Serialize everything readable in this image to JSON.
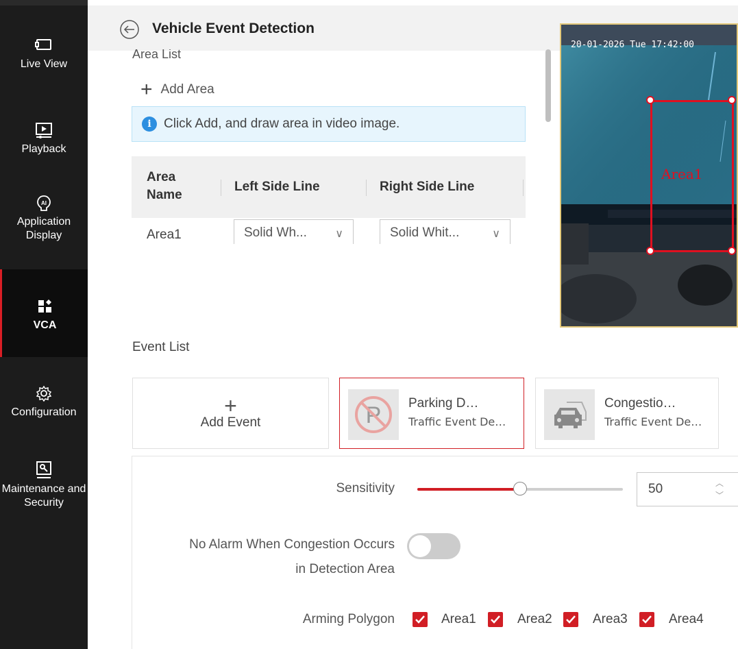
{
  "sidebar": {
    "items": [
      {
        "label": "Live View",
        "icon": "monitor-icon"
      },
      {
        "label": "Playback",
        "icon": "playback-icon"
      },
      {
        "label": "Application Display",
        "icon": "ai-icon"
      },
      {
        "label": "VCA",
        "icon": "vca-icon",
        "active": true
      },
      {
        "label": "Configuration",
        "icon": "gear-icon"
      },
      {
        "label": "Maintenance and Security",
        "icon": "maintenance-icon"
      }
    ]
  },
  "header": {
    "title": "Vehicle Event Detection"
  },
  "area_list": {
    "section_label": "Area List",
    "add_label": "Add Area",
    "info_text": "Click Add, and draw area in video image.",
    "columns": [
      "Area Name",
      "Left Side Line",
      "Right Side Line"
    ],
    "rows": [
      {
        "name": "Area1",
        "left_line": "Solid Wh...",
        "right_line": "Solid Whit..."
      }
    ]
  },
  "video": {
    "timestamp": "20-01-2026 Tue 17:42:00",
    "area_label": "Area1"
  },
  "event_list": {
    "title": "Event List",
    "add_label": "Add Event",
    "cards": [
      {
        "name": "Parking D…",
        "sub": "Traffic Event De…",
        "selected": true
      },
      {
        "name": "Congestio…",
        "sub": "Traffic Event De…",
        "selected": false
      }
    ]
  },
  "settings": {
    "sensitivity_label": "Sensitivity",
    "sensitivity_value": "50",
    "sensitivity_fraction": 0.5,
    "no_alarm_label_line1": "No Alarm When Congestion Occurs",
    "no_alarm_label_line2": "in Detection Area",
    "no_alarm_enabled": false,
    "arming_label": "Arming Polygon",
    "polygons": [
      "Area1",
      "Area2",
      "Area3",
      "Area4"
    ]
  },
  "colors": {
    "accent": "#d11e25",
    "sidebar": "#1c1c1c",
    "info": "#2d8fe0"
  }
}
